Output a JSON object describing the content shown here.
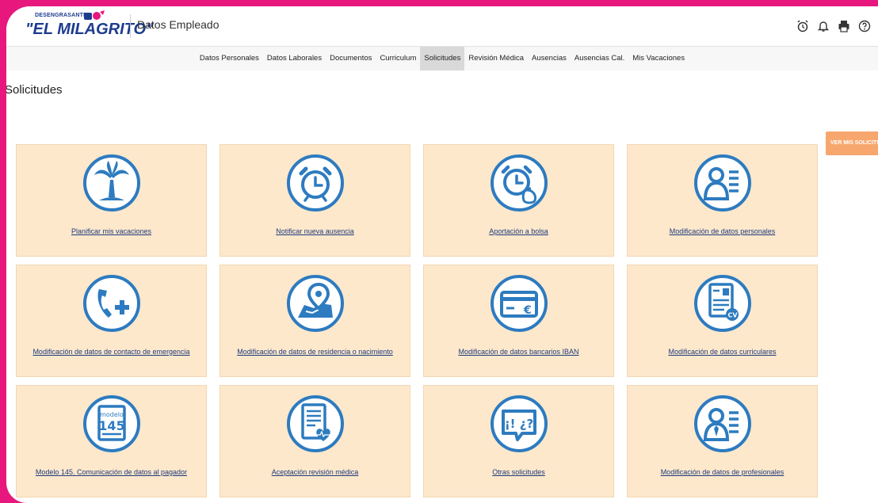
{
  "header": {
    "brand_small": "DESENGRASANTE",
    "brand_name": "\"EL MILAGRITO\"",
    "app_title": "Datos Empleado",
    "icons": [
      "alarm-icon",
      "bell-icon",
      "print-icon",
      "help-icon"
    ]
  },
  "tabs": [
    {
      "label": "Datos Personales",
      "active": false
    },
    {
      "label": "Datos Laborales",
      "active": false
    },
    {
      "label": "Documentos",
      "active": false
    },
    {
      "label": "Curriculum",
      "active": false
    },
    {
      "label": "Solicitudes",
      "active": true
    },
    {
      "label": "Revisión Médica",
      "active": false
    },
    {
      "label": "Ausencias",
      "active": false
    },
    {
      "label": "Ausencias Cal.",
      "active": false
    },
    {
      "label": "Mis Vacaciones",
      "active": false
    }
  ],
  "page": {
    "title": "Solicitudes",
    "action_button": "VER MIS SOLICITUDES"
  },
  "colors": {
    "accent_pink": "#e8177e",
    "brand_blue": "#1d3c8f",
    "icon_blue": "#2d7bc0",
    "card_bg": "#fde8cc",
    "button_orange": "#f7a76d"
  },
  "cards": [
    {
      "label": "Planificar mis vacaciones",
      "icon": "palm-tree-icon"
    },
    {
      "label": "Notificar nueva ausencia",
      "icon": "alarm-clock-icon"
    },
    {
      "label": "Aportación a bolsa",
      "icon": "clock-moneybag-icon"
    },
    {
      "label": "Modificación de datos personales",
      "icon": "person-list-icon"
    },
    {
      "label": "Modificación de datos de contacto de emergencia",
      "icon": "phone-plus-icon"
    },
    {
      "label": "Modificación de datos de residencia o nacimiento",
      "icon": "map-pin-icon"
    },
    {
      "label": "Modificación de datos bancarios IBAN",
      "icon": "credit-card-icon"
    },
    {
      "label": "Modificación de datos curriculares",
      "icon": "cv-document-icon"
    },
    {
      "label": "Modelo 145. Comunicación de datos al pagador",
      "icon": "modelo-145-icon",
      "icon_text_top": "modelo",
      "icon_text_num": "145"
    },
    {
      "label": "Aceptación revisión médica",
      "icon": "medical-document-icon"
    },
    {
      "label": "Otras solicitudes",
      "icon": "speech-question-icon",
      "icon_text": "¡! ¿?"
    },
    {
      "label": "Modificación de datos de profesionales",
      "icon": "professional-person-icon"
    }
  ]
}
